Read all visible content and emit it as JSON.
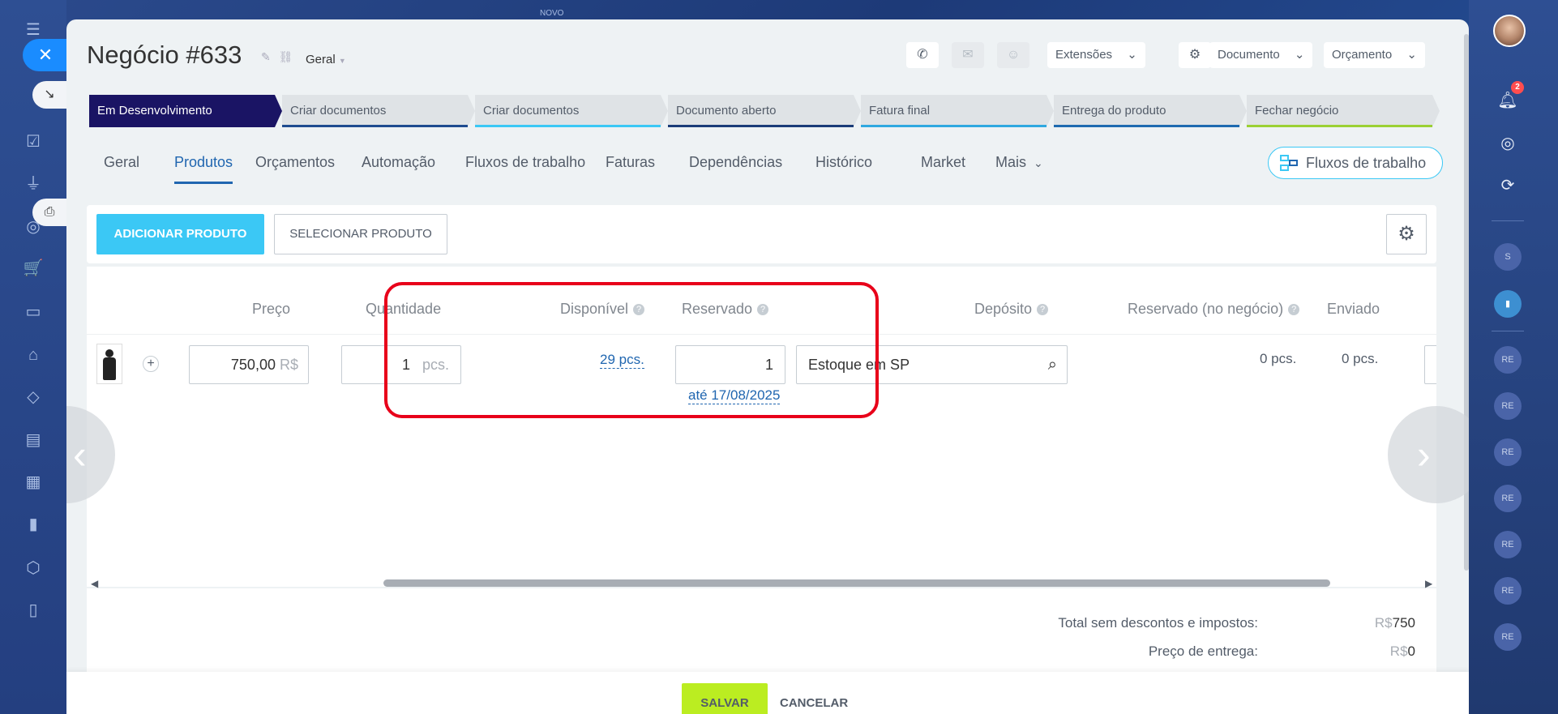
{
  "window": {
    "top_label": "NOVO"
  },
  "deal": {
    "title": "Negócio #633",
    "category": "Geral"
  },
  "header": {
    "extensions_label": "Extensões",
    "document_label": "Documento",
    "quote_label": "Orçamento"
  },
  "stages": [
    {
      "label": "Em Desenvolvimento",
      "bar_color": "#1a1464"
    },
    {
      "label": "Criar documentos",
      "bar_color": "#1e4b8f"
    },
    {
      "label": "Criar documentos",
      "bar_color": "#3bc8f5"
    },
    {
      "label": "Documento aberto",
      "bar_color": "#1a3c78"
    },
    {
      "label": "Fatura final",
      "bar_color": "#2fa8e0"
    },
    {
      "label": "Entrega do produto",
      "bar_color": "#1e6ab0"
    },
    {
      "label": "Fechar negócio",
      "bar_color": "#9bd033"
    }
  ],
  "tabs": [
    "Geral",
    "Produtos",
    "Orçamentos",
    "Automação",
    "Fluxos de trabalho",
    "Faturas",
    "Dependências",
    "Histórico",
    "Market",
    "Mais"
  ],
  "active_tab": "Produtos",
  "flows_button": "Fluxos de trabalho",
  "toolbar": {
    "add_label": "ADICIONAR PRODUTO",
    "select_label": "SELECIONAR PRODUTO"
  },
  "columns": {
    "price": "Preço",
    "quantity": "Quantidade",
    "available": "Disponível",
    "reserved": "Reservado",
    "warehouse": "Depósito",
    "reserved_deal": "Reservado (no negócio)",
    "shipped": "Enviado"
  },
  "row": {
    "price": "750,00",
    "currency": "R$",
    "quantity": "1",
    "unit": "pcs.",
    "available": "29 pcs.",
    "reserved": "1",
    "reserved_until": "até 17/08/2025",
    "warehouse": "Estoque em SP",
    "reserved_deal": "0 pcs.",
    "shipped": "0 pcs."
  },
  "totals": {
    "subtotal_label": "Total sem descontos e impostos:",
    "subtotal_currency": "R$",
    "subtotal_value": "750",
    "delivery_label": "Preço de entrega:",
    "delivery_currency": "R$",
    "delivery_value": "0"
  },
  "footer": {
    "save_label": "SALVAR",
    "cancel_label": "CANCELAR"
  },
  "right_sidebar": {
    "notification_count": "2",
    "avatar_initials": [
      "S",
      "RE",
      "RE",
      "RE",
      "RE",
      "RE",
      "RE",
      "RE"
    ]
  },
  "colors": {
    "accent": "#3bc8f5",
    "save": "#bbed21",
    "highlight": "#e8001a",
    "link": "#2066b0"
  }
}
